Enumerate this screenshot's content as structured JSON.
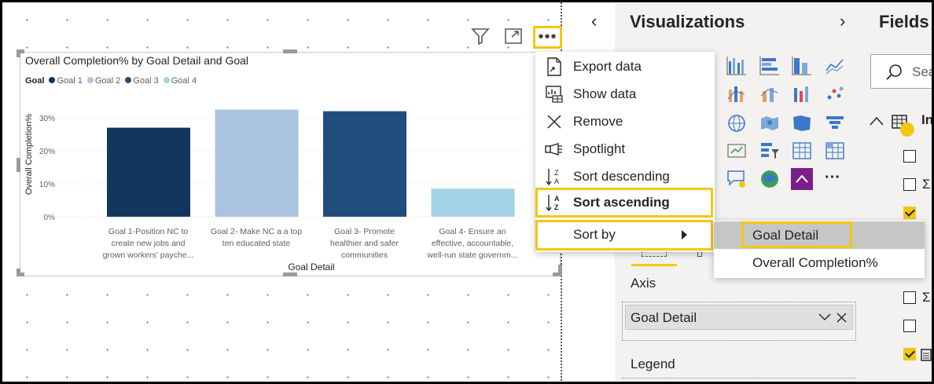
{
  "visual": {
    "title": "Overall Completion% by Goal Detail and Goal",
    "legend_title": "Goal",
    "legend_items": [
      {
        "label": "Goal 1",
        "color": "#12375f"
      },
      {
        "label": "Goal 2",
        "color": "#a9c4e0"
      },
      {
        "label": "Goal 3",
        "color": "#1f4e7e"
      },
      {
        "label": "Goal 4",
        "color": "#a3d3e6"
      }
    ]
  },
  "chart_data": {
    "type": "bar",
    "title": "Overall Completion% by Goal Detail and Goal",
    "xlabel": "Goal Detail",
    "ylabel": "Overall Completion%",
    "ylim": [
      0,
      35
    ],
    "yticks": [
      "0%",
      "10%",
      "20%",
      "30%"
    ],
    "ytick_values": [
      0,
      10,
      20,
      30
    ],
    "grid": true,
    "legend_position": "top-left",
    "categories": [
      [
        "Goal 1-Position NC to",
        "create new jobs and",
        "grown workers' payche..."
      ],
      [
        "Goal 2- Make NC a a top",
        "ten educated state"
      ],
      [
        "Goal 3- Promote",
        "healthier and safer",
        "communities"
      ],
      [
        "Goal 4- Ensure an",
        "effective, accountable,",
        "well-run state governm..."
      ]
    ],
    "values": [
      27,
      32.5,
      32,
      8.5
    ],
    "colors": [
      "#12375f",
      "#a9c4e0",
      "#1f4e7e",
      "#a3d3e6"
    ]
  },
  "header_icons": {
    "filter": "filter-icon",
    "focus": "focus-mode-icon",
    "more": "more-options-icon",
    "more_label": "•••"
  },
  "context_menu": {
    "items": [
      {
        "label": "Export data",
        "icon": "export-icon"
      },
      {
        "label": "Show data",
        "icon": "show-data-icon"
      },
      {
        "label": "Remove",
        "icon": "close-icon"
      },
      {
        "label": "Spotlight",
        "icon": "spotlight-icon"
      },
      {
        "label": "Sort descending",
        "icon": "sort-descending-icon"
      },
      {
        "label": "Sort ascending",
        "icon": "sort-ascending-icon"
      },
      {
        "label": "Sort by",
        "icon": ""
      }
    ]
  },
  "sort_submenu": {
    "items": [
      {
        "label": "Goal Detail"
      },
      {
        "label": "Overall Completion%"
      }
    ]
  },
  "viz_pane": {
    "title": "Visualizations",
    "more_label": "···",
    "axis_label": "Axis",
    "axis_field": "Goal Detail",
    "legend_label": "Legend"
  },
  "fields_pane": {
    "title": "Fields",
    "search_placeholder": "Sea",
    "table_label": "In",
    "sigma": "Σ"
  }
}
